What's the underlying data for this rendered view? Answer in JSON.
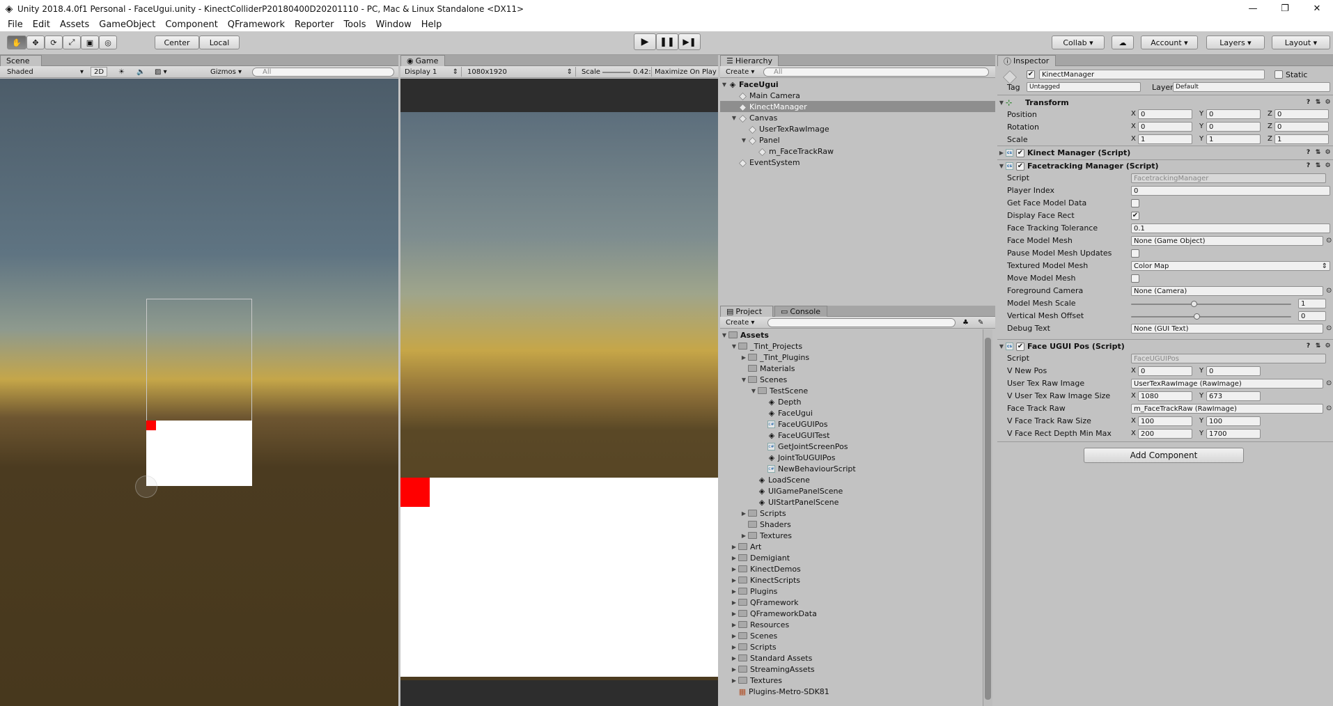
{
  "window": {
    "title": "Unity 2018.4.0f1 Personal - FaceUgui.unity - KinectColliderP20180400D20201110 - PC, Mac & Linux Standalone <DX11>"
  },
  "menu": [
    "File",
    "Edit",
    "Assets",
    "GameObject",
    "Component",
    "QFramework",
    "Reporter",
    "Tools",
    "Window",
    "Help"
  ],
  "toolbar": {
    "center": "Center",
    "local": "Local",
    "collab": "Collab ▾",
    "account": "Account",
    "layers": "Layers",
    "layout": "Layout"
  },
  "scene": {
    "tab": "Scene",
    "shading": "Shaded",
    "mode2d": "2D",
    "gizmos": "Gizmos",
    "search": "All"
  },
  "game": {
    "tab": "Game",
    "display": "Display 1",
    "resolution": "1080x1920",
    "scale_label": "Scale",
    "scale_value": "0.42:",
    "maximize": "Maximize On Play"
  },
  "hierarchy": {
    "tab": "Hierarchy",
    "create": "Create",
    "search": "All",
    "scene_name": "FaceUgui",
    "items": [
      {
        "label": "Main Camera",
        "depth": 1,
        "arrow": ""
      },
      {
        "label": "KinectManager",
        "depth": 1,
        "arrow": "",
        "selected": true
      },
      {
        "label": "Canvas",
        "depth": 1,
        "arrow": "▼"
      },
      {
        "label": "UserTexRawImage",
        "depth": 2,
        "arrow": ""
      },
      {
        "label": "Panel",
        "depth": 2,
        "arrow": "▼"
      },
      {
        "label": "m_FaceTrackRaw",
        "depth": 3,
        "arrow": ""
      },
      {
        "label": "EventSystem",
        "depth": 1,
        "arrow": ""
      }
    ]
  },
  "project": {
    "tab": "Project",
    "console_tab": "Console",
    "create": "Create",
    "root": "Assets",
    "items": [
      {
        "label": "_Tint_Projects",
        "depth": 1,
        "arrow": "▼",
        "icon": "folder"
      },
      {
        "label": "_Tint_Plugins",
        "depth": 2,
        "arrow": "▶",
        "icon": "folder"
      },
      {
        "label": "Materials",
        "depth": 2,
        "arrow": "",
        "icon": "folder"
      },
      {
        "label": "Scenes",
        "depth": 2,
        "arrow": "▼",
        "icon": "folder"
      },
      {
        "label": "TestScene",
        "depth": 3,
        "arrow": "▼",
        "icon": "folder"
      },
      {
        "label": "Depth",
        "depth": 4,
        "arrow": "",
        "icon": "unity"
      },
      {
        "label": "FaceUgui",
        "depth": 4,
        "arrow": "",
        "icon": "unity"
      },
      {
        "label": "FaceUGUIPos",
        "depth": 4,
        "arrow": "",
        "icon": "cs"
      },
      {
        "label": "FaceUGUITest",
        "depth": 4,
        "arrow": "",
        "icon": "unity"
      },
      {
        "label": "GetJointScreenPos",
        "depth": 4,
        "arrow": "",
        "icon": "cs"
      },
      {
        "label": "JointToUGUIPos",
        "depth": 4,
        "arrow": "",
        "icon": "unity"
      },
      {
        "label": "NewBehaviourScript",
        "depth": 4,
        "arrow": "",
        "icon": "cs"
      },
      {
        "label": "LoadScene",
        "depth": 3,
        "arrow": "",
        "icon": "unity"
      },
      {
        "label": "UIGamePanelScene",
        "depth": 3,
        "arrow": "",
        "icon": "unity"
      },
      {
        "label": "UIStartPanelScene",
        "depth": 3,
        "arrow": "",
        "icon": "unity"
      },
      {
        "label": "Scripts",
        "depth": 2,
        "arrow": "▶",
        "icon": "folder"
      },
      {
        "label": "Shaders",
        "depth": 2,
        "arrow": "",
        "icon": "folder"
      },
      {
        "label": "Textures",
        "depth": 2,
        "arrow": "▶",
        "icon": "folder"
      },
      {
        "label": "Art",
        "depth": 1,
        "arrow": "▶",
        "icon": "folder"
      },
      {
        "label": "Demigiant",
        "depth": 1,
        "arrow": "▶",
        "icon": "folder"
      },
      {
        "label": "KinectDemos",
        "depth": 1,
        "arrow": "▶",
        "icon": "folder"
      },
      {
        "label": "KinectScripts",
        "depth": 1,
        "arrow": "▶",
        "icon": "folder"
      },
      {
        "label": "Plugins",
        "depth": 1,
        "arrow": "▶",
        "icon": "folder"
      },
      {
        "label": "QFramework",
        "depth": 1,
        "arrow": "▶",
        "icon": "folder"
      },
      {
        "label": "QFrameworkData",
        "depth": 1,
        "arrow": "▶",
        "icon": "folder"
      },
      {
        "label": "Resources",
        "depth": 1,
        "arrow": "▶",
        "icon": "folder"
      },
      {
        "label": "Scenes",
        "depth": 1,
        "arrow": "▶",
        "icon": "folder"
      },
      {
        "label": "Scripts",
        "depth": 1,
        "arrow": "▶",
        "icon": "folder"
      },
      {
        "label": "Standard Assets",
        "depth": 1,
        "arrow": "▶",
        "icon": "folder"
      },
      {
        "label": "StreamingAssets",
        "depth": 1,
        "arrow": "▶",
        "icon": "folder"
      },
      {
        "label": "Textures",
        "depth": 1,
        "arrow": "▶",
        "icon": "folder"
      },
      {
        "label": "Plugins-Metro-SDK81",
        "depth": 1,
        "arrow": "",
        "icon": "package"
      }
    ]
  },
  "inspector": {
    "tab": "Inspector",
    "object_name": "KinectManager",
    "static_label": "Static",
    "tag_label": "Tag",
    "tag_value": "Untagged",
    "layer_label": "Layer",
    "layer_value": "Default",
    "transform": {
      "title": "Transform",
      "position_label": "Position",
      "position": {
        "x": "0",
        "y": "0",
        "z": "0"
      },
      "rotation_label": "Rotation",
      "rotation": {
        "x": "0",
        "y": "0",
        "z": "0"
      },
      "scale_label": "Scale",
      "scale": {
        "x": "1",
        "y": "1",
        "z": "1"
      }
    },
    "kinect_manager": {
      "title": "Kinect Manager (Script)"
    },
    "facetracking": {
      "title": "Facetracking Manager (Script)",
      "script_label": "Script",
      "script_value": "FacetrackingManager",
      "player_index_label": "Player Index",
      "player_index": "0",
      "get_face_model_label": "Get Face Model Data",
      "get_face_model": false,
      "display_face_rect_label": "Display Face Rect",
      "display_face_rect": true,
      "tolerance_label": "Face Tracking Tolerance",
      "tolerance": "0.1",
      "mesh_label": "Face Model Mesh",
      "mesh": "None (Game Object)",
      "pause_label": "Pause Model Mesh Updates",
      "pause": false,
      "textured_label": "Textured Model Mesh",
      "textured": "Color Map",
      "move_label": "Move Model Mesh",
      "move": false,
      "fg_camera_label": "Foreground Camera",
      "fg_camera": "None (Camera)",
      "mesh_scale_label": "Model Mesh Scale",
      "mesh_scale": "1",
      "mesh_offset_label": "Vertical Mesh Offset",
      "mesh_offset": "0",
      "debug_text_label": "Debug Text",
      "debug_text": "None (GUI Text)"
    },
    "faceugui": {
      "title": "Face UGUI Pos (Script)",
      "script_label": "Script",
      "script_value": "FaceUGUIPos",
      "v_new_pos_label": "V New Pos",
      "v_new_pos": {
        "x": "0",
        "y": "0"
      },
      "user_tex_label": "User Tex Raw Image",
      "user_tex": "UserTexRawImage (RawImage)",
      "user_tex_size_label": "V User Tex Raw Image Size",
      "user_tex_size": {
        "x": "1080",
        "y": "673"
      },
      "face_track_label": "Face Track Raw",
      "face_track": "m_FaceTrackRaw (RawImage)",
      "face_track_size_label": "V Face Track Raw Size",
      "face_track_size": {
        "x": "100",
        "y": "100"
      },
      "depth_label": "V Face Rect Depth Min Max",
      "depth": {
        "x": "200",
        "y": "1700"
      }
    },
    "add_component": "Add Component"
  },
  "colors": {
    "sky_top": "#4e5f6c",
    "horizon": "#c9a64a",
    "ground": "#4a3a1f",
    "face_rect": "#ff0000",
    "selection": "#8e8e8e"
  }
}
